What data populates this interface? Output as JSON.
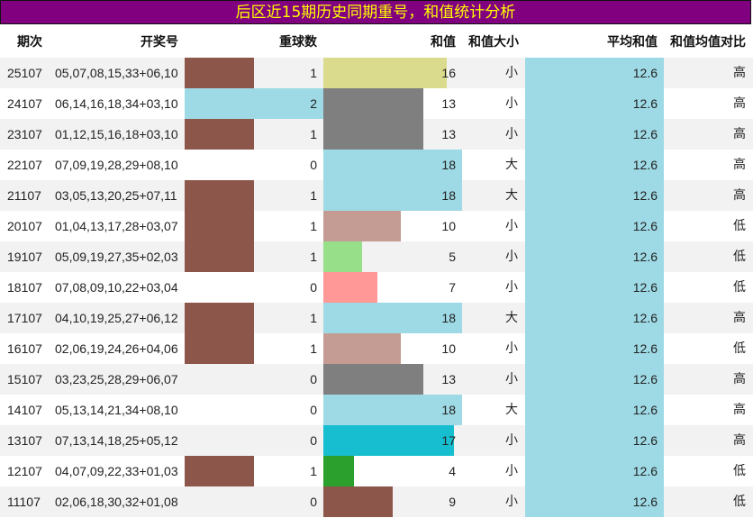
{
  "title": "后区近15期历史同期重号，和值统计分析",
  "headers": {
    "period": "期次",
    "numbers": "开奖号",
    "repeat": "重球数",
    "sum": "和值",
    "size": "和值大小",
    "avg": "平均和值",
    "compare": "和值均值对比"
  },
  "colors": {
    "title_bg": "#800080",
    "title_text": "#ffff00",
    "row_alt": "#f2f2f2",
    "repeat_bar": "#8c564b",
    "avg_bar": "#9edae5"
  },
  "chart_data": {
    "type": "table",
    "columns": [
      "期次",
      "开奖号",
      "重球数",
      "和值",
      "和值大小",
      "平均和值",
      "和值均值对比"
    ],
    "repeat_range": [
      0,
      2
    ],
    "sum_range": [
      0,
      18
    ],
    "rows": [
      {
        "period": "25107",
        "numbers": "05,07,08,15,33+06,10",
        "repeat": 1,
        "sum": 16,
        "size": "小",
        "avg": "12.6",
        "compare": "高",
        "sum_color": "#dbdb8d"
      },
      {
        "period": "24107",
        "numbers": "06,14,16,18,34+03,10",
        "repeat": 2,
        "sum": 13,
        "size": "小",
        "avg": "12.6",
        "compare": "高",
        "sum_color": "#7f7f7f"
      },
      {
        "period": "23107",
        "numbers": "01,12,15,16,18+03,10",
        "repeat": 1,
        "sum": 13,
        "size": "小",
        "avg": "12.6",
        "compare": "高",
        "sum_color": "#7f7f7f"
      },
      {
        "period": "22107",
        "numbers": "07,09,19,28,29+08,10",
        "repeat": 0,
        "sum": 18,
        "size": "大",
        "avg": "12.6",
        "compare": "高",
        "sum_color": "#9edae5"
      },
      {
        "period": "21107",
        "numbers": "03,05,13,20,25+07,11",
        "repeat": 1,
        "sum": 18,
        "size": "大",
        "avg": "12.6",
        "compare": "高",
        "sum_color": "#9edae5"
      },
      {
        "period": "20107",
        "numbers": "01,04,13,17,28+03,07",
        "repeat": 1,
        "sum": 10,
        "size": "小",
        "avg": "12.6",
        "compare": "低",
        "sum_color": "#c49c94"
      },
      {
        "period": "19107",
        "numbers": "05,09,19,27,35+02,03",
        "repeat": 1,
        "sum": 5,
        "size": "小",
        "avg": "12.6",
        "compare": "低",
        "sum_color": "#98df8a"
      },
      {
        "period": "18107",
        "numbers": "07,08,09,10,22+03,04",
        "repeat": 0,
        "sum": 7,
        "size": "小",
        "avg": "12.6",
        "compare": "低",
        "sum_color": "#ff9896"
      },
      {
        "period": "17107",
        "numbers": "04,10,19,25,27+06,12",
        "repeat": 1,
        "sum": 18,
        "size": "大",
        "avg": "12.6",
        "compare": "高",
        "sum_color": "#9edae5"
      },
      {
        "period": "16107",
        "numbers": "02,06,19,24,26+04,06",
        "repeat": 1,
        "sum": 10,
        "size": "小",
        "avg": "12.6",
        "compare": "低",
        "sum_color": "#c49c94"
      },
      {
        "period": "15107",
        "numbers": "03,23,25,28,29+06,07",
        "repeat": 0,
        "sum": 13,
        "size": "小",
        "avg": "12.6",
        "compare": "高",
        "sum_color": "#7f7f7f"
      },
      {
        "period": "14107",
        "numbers": "05,13,14,21,34+08,10",
        "repeat": 0,
        "sum": 18,
        "size": "大",
        "avg": "12.6",
        "compare": "高",
        "sum_color": "#9edae5"
      },
      {
        "period": "13107",
        "numbers": "07,13,14,18,25+05,12",
        "repeat": 0,
        "sum": 17,
        "size": "小",
        "avg": "12.6",
        "compare": "高",
        "sum_color": "#17becf"
      },
      {
        "period": "12107",
        "numbers": "04,07,09,22,33+01,03",
        "repeat": 1,
        "sum": 4,
        "size": "小",
        "avg": "12.6",
        "compare": "低",
        "sum_color": "#2ca02c"
      },
      {
        "period": "11107",
        "numbers": "02,06,18,30,32+01,08",
        "repeat": 0,
        "sum": 9,
        "size": "小",
        "avg": "12.6",
        "compare": "低",
        "sum_color": "#8c564b"
      }
    ]
  }
}
